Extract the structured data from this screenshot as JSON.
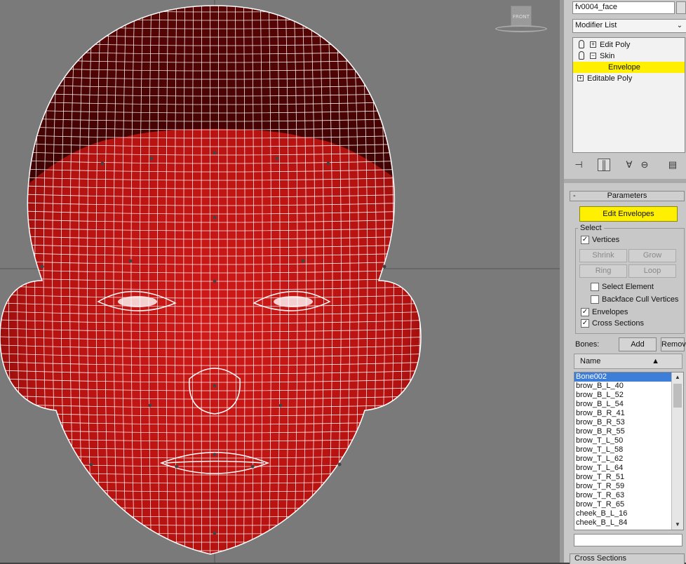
{
  "viewport": {
    "view_label": "FRONT"
  },
  "panel": {
    "object_name": "fv0004_face",
    "modifier_list_label": "Modifier List",
    "stack": [
      {
        "label": "Edit Poly"
      },
      {
        "label": "Skin"
      },
      {
        "label": "Envelope"
      },
      {
        "label": "Editable Poly"
      }
    ],
    "parameters_title": "Parameters",
    "edit_envelopes_label": "Edit Envelopes",
    "select_group_title": "Select",
    "vertices_label": "Vertices",
    "shrink_label": "Shrink",
    "grow_label": "Grow",
    "ring_label": "Ring",
    "loop_label": "Loop",
    "select_element_label": "Select Element",
    "backface_cull_label": "Backface Cull Vertices",
    "envelopes_label": "Envelopes",
    "cross_sections_label": "Cross Sections",
    "bones_label": "Bones:",
    "add_label": "Add",
    "remove_label": "Remove",
    "name_header": "Name",
    "bones": [
      "Bone002",
      "brow_B_L_40",
      "brow_B_L_52",
      "brow_B_L_54",
      "brow_B_R_41",
      "brow_B_R_53",
      "brow_B_R_55",
      "brow_T_L_50",
      "brow_T_L_58",
      "brow_T_L_62",
      "brow_T_L_64",
      "brow_T_R_51",
      "brow_T_R_59",
      "brow_T_R_63",
      "brow_T_R_65",
      "cheek_B_L_16",
      "cheek_B_L_84"
    ],
    "cross_sections_rollout": "Cross Sections"
  }
}
